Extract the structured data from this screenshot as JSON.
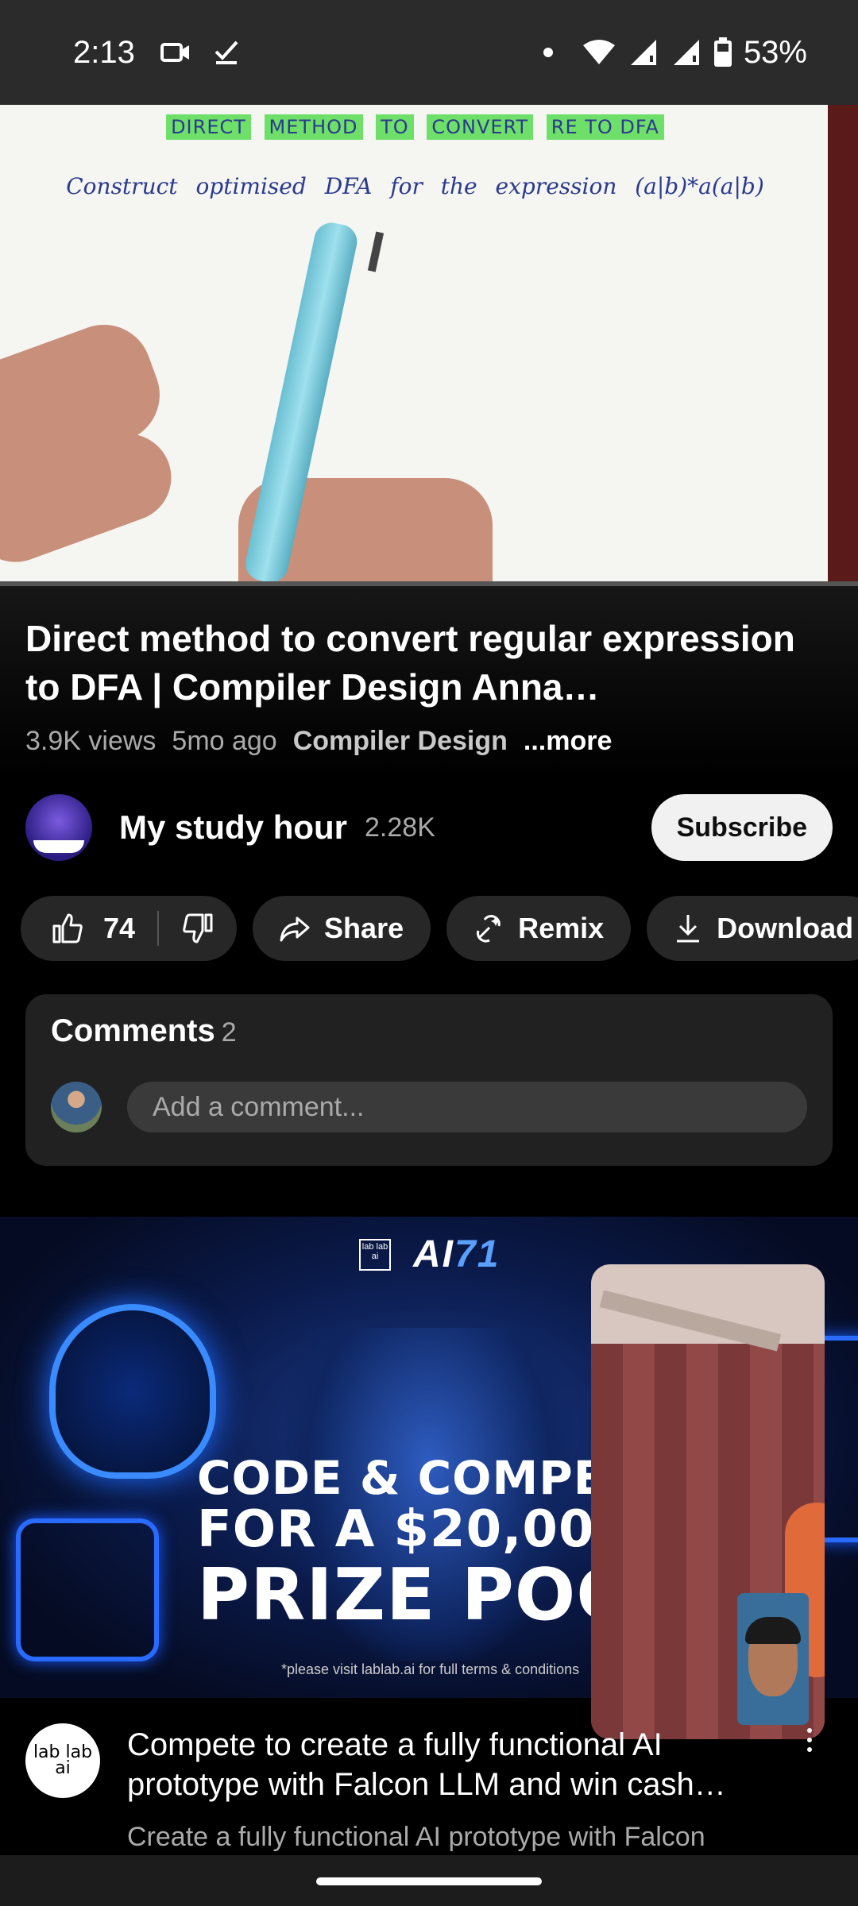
{
  "status_bar": {
    "time": "2:13",
    "battery_percent": "53%"
  },
  "video": {
    "board_heading_words": [
      "DIRECT",
      "METHOD",
      "TO",
      "CONVERT",
      "RE TO DFA"
    ],
    "board_line": "Construct optimised DFA for the expression (a|b)*a(a|b)"
  },
  "info": {
    "title": "Direct method to convert regular expression to DFA | Compiler Design Anna…",
    "views": "3.9K views",
    "age": "5mo ago",
    "playlist": "Compiler Design",
    "more_label": "...more"
  },
  "channel": {
    "name": "My study hour",
    "subscribers": "2.28K",
    "subscribe_label": "Subscribe"
  },
  "actions": {
    "like_count": "74",
    "share_label": "Share",
    "remix_label": "Remix",
    "download_label": "Download"
  },
  "comments": {
    "title": "Comments",
    "count": "2",
    "placeholder": "Add a comment..."
  },
  "ad_thumbnail": {
    "brand_box": "lab lab ai",
    "brand_prefix": "AI",
    "brand_number": "71",
    "headline_1": "CODE & COMPET",
    "headline_2": "FOR A $20,00",
    "headline_3": "PRIZE POC",
    "fine_print": "*please visit lablab.ai for full terms & conditions"
  },
  "next_video": {
    "channel_logo_text": "lab lab ai",
    "title": "Compete to create a fully functional AI prototype with Falcon LLM and win cash…",
    "description": "Create a fully functional AI prototype with Falcon"
  },
  "colors": {
    "background": "#000000",
    "status_bar": "#2b2b2b",
    "pill": "#272727",
    "comments_box": "#212121",
    "secondary_text": "#aaaaaa",
    "highlighter": "#6ee06a"
  },
  "icons": [
    "camera-icon",
    "checkmark-icon",
    "wifi-icon",
    "signal-icon",
    "battery-icon",
    "like-icon",
    "dislike-icon",
    "share-icon",
    "remix-icon",
    "download-icon",
    "more-vert-icon"
  ]
}
